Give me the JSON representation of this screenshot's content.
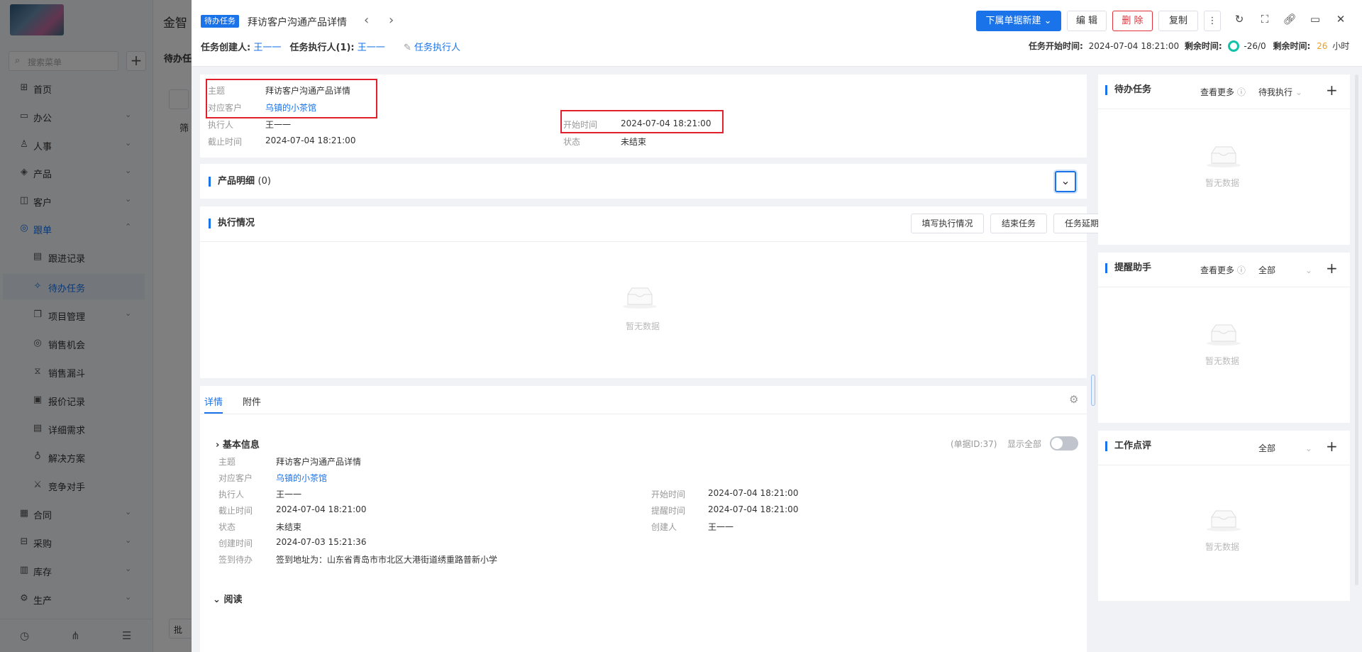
{
  "app": {
    "name": "金智"
  },
  "sidebar": {
    "search_placeholder": "搜索菜单",
    "items": [
      {
        "label": "首页",
        "icon": "home-icon"
      },
      {
        "label": "办公",
        "icon": "office-icon"
      },
      {
        "label": "人事",
        "icon": "people-icon"
      },
      {
        "label": "产品",
        "icon": "product-icon"
      },
      {
        "label": "客户",
        "icon": "customer-icon"
      },
      {
        "label": "跟单",
        "icon": "follow-icon"
      },
      {
        "label": "跟进记录",
        "icon": "record-icon"
      },
      {
        "label": "待办任务",
        "icon": "pin-icon"
      },
      {
        "label": "项目管理",
        "icon": "project-icon"
      },
      {
        "label": "销售机会",
        "icon": "opportunity-icon"
      },
      {
        "label": "销售漏斗",
        "icon": "funnel-icon"
      },
      {
        "label": "报价记录",
        "icon": "quote-icon"
      },
      {
        "label": "详细需求",
        "icon": "requirement-icon"
      },
      {
        "label": "解决方案",
        "icon": "solution-icon"
      },
      {
        "label": "竞争对手",
        "icon": "competitor-icon"
      },
      {
        "label": "合同",
        "icon": "contract-icon"
      },
      {
        "label": "采购",
        "icon": "purchase-icon"
      },
      {
        "label": "库存",
        "icon": "inventory-icon"
      },
      {
        "label": "生产",
        "icon": "production-icon"
      }
    ]
  },
  "bg_main": {
    "title": "待办任",
    "filter": "筛",
    "batch": "批"
  },
  "drawer": {
    "tag": "待办任务",
    "title": "拜访客户沟通产品详情",
    "creator_label": "任务创建人:",
    "creator": "王一一",
    "executor_label": "任务执行人(1):",
    "executor": "王一一",
    "executor_link": "任务执行人",
    "buttons": {
      "create_sub": "下属单据新建",
      "edit": "编 辑",
      "delete": "删 除",
      "copy": "复制"
    },
    "start_label": "任务开始时间:",
    "start_value": "2024-07-04 18:21:00",
    "remaining_label": "剩余时间:",
    "remaining_count": "-26/0",
    "remaining_label2": "剩余时间:",
    "remaining_hours": "26",
    "hours_unit": "小时"
  },
  "summary": {
    "subject_label": "主题",
    "subject": "拜访客户沟通产品详情",
    "customer_label": "对应客户",
    "customer": "乌镇的小茶馆",
    "executor_label": "执行人",
    "executor": "王一一",
    "deadline_label": "截止时间",
    "deadline": "2024-07-04 18:21:00",
    "start_label": "开始时间",
    "start": "2024-07-04 18:21:00",
    "status_label": "状态",
    "status": "未结束"
  },
  "products": {
    "title": "产品明细",
    "count": "(0)"
  },
  "execution": {
    "title": "执行情况",
    "btn_fill": "填写执行情况",
    "btn_end": "结束任务",
    "btn_delay": "任务延期",
    "empty": "暂无数据"
  },
  "details": {
    "tab_detail": "详情",
    "tab_attach": "附件",
    "basic_title": "基本信息",
    "doc_id": "(单据ID:37)",
    "show_all": "显示全部",
    "subject_label": "主题",
    "subject": "拜访客户沟通产品详情",
    "customer_label": "对应客户",
    "customer": "乌镇的小茶馆",
    "executor_label": "执行人",
    "executor": "王一一",
    "deadline_label": "截止时间",
    "deadline": "2024-07-04 18:21:00",
    "status_label": "状态",
    "status": "未结束",
    "created_label": "创建时间",
    "created": "2024-07-03 15:21:36",
    "checkin_label": "签到待办",
    "checkin": "签到地址为：山东省青岛市市北区大港街道绣重路普新小学",
    "start_label": "开始时间",
    "start": "2024-07-04 18:21:00",
    "remind_label": "提醒时间",
    "remind": "2024-07-04 18:21:00",
    "creator_label": "创建人",
    "creator": "王一一",
    "read_title": "阅读"
  },
  "right_panels": [
    {
      "title": "待办任务",
      "more": "查看更多",
      "select": "待我执行",
      "empty": "暂无数据"
    },
    {
      "title": "提醒助手",
      "more": "查看更多",
      "select": "全部",
      "empty": "暂无数据"
    },
    {
      "title": "工作点评",
      "select": "全部",
      "empty": "暂无数据"
    }
  ],
  "colors": {
    "accent": "#1a73e8",
    "danger": "#e0303a",
    "highlight_box": "#e0202a",
    "ring": "#12c2a8",
    "hours": "#f0a020"
  }
}
